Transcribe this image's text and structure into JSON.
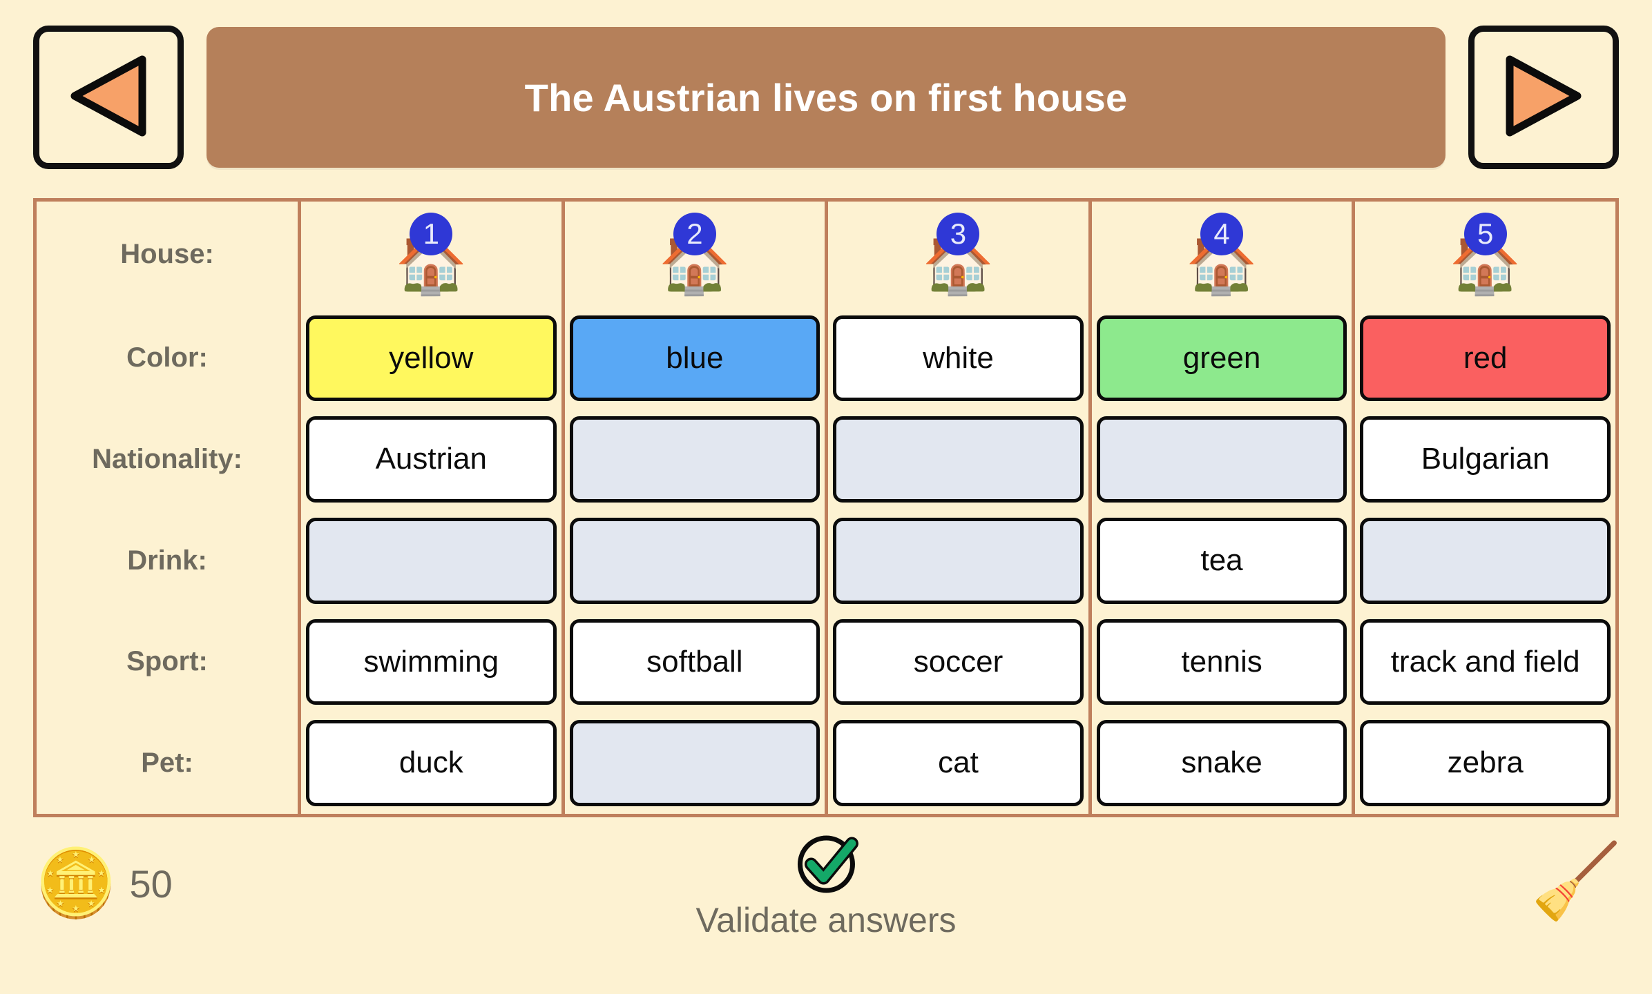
{
  "nav": {
    "prev_label": "previous-clue",
    "next_label": "next-clue"
  },
  "banner": {
    "clue_text": "The Austrian lives on first house"
  },
  "grid": {
    "row_labels": [
      "House:",
      "Color:",
      "Nationality:",
      "Drink:",
      "Sport:",
      "Pet:"
    ],
    "house_numbers": [
      "1",
      "2",
      "3",
      "4",
      "5"
    ],
    "rows": [
      {
        "key": "color",
        "cells": [
          {
            "text": "yellow",
            "filled": true,
            "bg": "#FFF85E"
          },
          {
            "text": "blue",
            "filled": true,
            "bg": "#59A8F5"
          },
          {
            "text": "white",
            "filled": true,
            "bg": "#FFFFFF"
          },
          {
            "text": "green",
            "filled": true,
            "bg": "#8DE98D"
          },
          {
            "text": "red",
            "filled": true,
            "bg": "#FA6060"
          }
        ]
      },
      {
        "key": "nationality",
        "cells": [
          {
            "text": "Austrian",
            "filled": true,
            "bg": "#FFFFFF"
          },
          {
            "text": "",
            "filled": false,
            "bg": "#E2E7F0"
          },
          {
            "text": "",
            "filled": false,
            "bg": "#E2E7F0"
          },
          {
            "text": "",
            "filled": false,
            "bg": "#E2E7F0"
          },
          {
            "text": "Bulgarian",
            "filled": true,
            "bg": "#FFFFFF"
          }
        ]
      },
      {
        "key": "drink",
        "cells": [
          {
            "text": "",
            "filled": false,
            "bg": "#E2E7F0"
          },
          {
            "text": "",
            "filled": false,
            "bg": "#E2E7F0"
          },
          {
            "text": "",
            "filled": false,
            "bg": "#E2E7F0"
          },
          {
            "text": "tea",
            "filled": true,
            "bg": "#FFFFFF"
          },
          {
            "text": "",
            "filled": false,
            "bg": "#E2E7F0"
          }
        ]
      },
      {
        "key": "sport",
        "cells": [
          {
            "text": "swimming",
            "filled": true,
            "bg": "#FFFFFF"
          },
          {
            "text": "softball",
            "filled": true,
            "bg": "#FFFFFF"
          },
          {
            "text": "soccer",
            "filled": true,
            "bg": "#FFFFFF"
          },
          {
            "text": "tennis",
            "filled": true,
            "bg": "#FFFFFF"
          },
          {
            "text": "track and field",
            "filled": true,
            "bg": "#FFFFFF"
          }
        ]
      },
      {
        "key": "pet",
        "cells": [
          {
            "text": "duck",
            "filled": true,
            "bg": "#FFFFFF"
          },
          {
            "text": "",
            "filled": false,
            "bg": "#E2E7F0"
          },
          {
            "text": "cat",
            "filled": true,
            "bg": "#FFFFFF"
          },
          {
            "text": "snake",
            "filled": true,
            "bg": "#FFFFFF"
          },
          {
            "text": "zebra",
            "filled": true,
            "bg": "#FFFFFF"
          }
        ]
      }
    ]
  },
  "footer": {
    "coin_count": "50",
    "coin_icon": "coins-icon",
    "validate_label": "Validate answers",
    "validate_icon": "check-circle-icon",
    "clear_icon": "broom-icon"
  },
  "theme": {
    "page_bg": "#FDF2D2",
    "banner_bg": "#B5805A",
    "grid_border": "#BF7F5C",
    "label_text": "#6E6A5E",
    "badge_blue": "#2F38D6",
    "arrow_orange": "#F7A168",
    "check_green": "#14A868"
  }
}
